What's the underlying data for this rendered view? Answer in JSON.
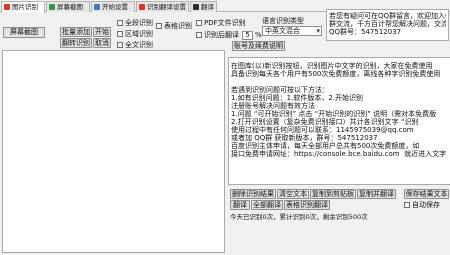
{
  "tabs": [
    {
      "label": "图片识别",
      "icon": "image-icon",
      "icon_color": "#d8382c",
      "active": true
    },
    {
      "label": "屏幕截图",
      "icon": "screenshot-icon",
      "icon_color": "#2f9a45",
      "active": false
    },
    {
      "label": "开始设置",
      "icon": "settings-icon",
      "icon_color": "#4a78b8",
      "active": false
    },
    {
      "label": "识别翻译设置",
      "icon": "translate-icon",
      "icon_color": "#d8382c",
      "active": false
    },
    {
      "label": "翻译",
      "icon": "globe-icon",
      "icon_color": "#2b2b2b",
      "active": false
    }
  ],
  "toolbar": {
    "screenshot_button": "屏幕截图",
    "batch_add_button": "批量添加",
    "start_button": "开始",
    "rotate_button": "翻转识别",
    "cancel_button": "取消",
    "options": [
      {
        "label": "全段识别",
        "checked": false
      },
      {
        "label": "区域识别",
        "checked": false
      },
      {
        "label": "全文识别",
        "checked": false
      },
      {
        "label": "表格识别",
        "checked": false
      },
      {
        "label": "PDF文件识别",
        "checked": false
      },
      {
        "label": "识别后翻译",
        "checked": false
      }
    ],
    "translate_value": "5",
    "translate_unit": "%",
    "language_label": "语言识别类型",
    "language_value": "中英文混合",
    "account_button": "账号及续费说明"
  },
  "notice": {
    "lines": [
      "若您有疑问可在QQ群留言，欢迎加入QQ",
      "群交流，千方百计帮您解决问题，交流",
      "QQ群号：547512037"
    ]
  },
  "result": {
    "lines": [
      "在图库(以)新识别按钮，识别图片中文字的识别，大家在免费使用",
      "具备识别每天各个用户有500次免费额度，离线各种字识别免费使用",
      "",
      "若遇到识别问题可按以下方法：",
      "1.如有识别问题：1.软件版本，2.开始识别",
      "注册账号解决问题有效方法",
      "1.问题 “可开始识别” 点击 “开始识别的识别” 说明（需对本免费版",
      "2.打开识别设置（复杂免费识别接口）共计各识别文字 “识别",
      "使用过程中有任何问题可以联系：1145975039@qq.com",
      "或者加 QQ群 获取新版本，群号：547512037",
      "百度识别主体申请，每天全部用户总共有500次免费额度，如",
      "接口免费申请网址：https://console.bce.baidu.com  就近进入文字"
    ]
  },
  "actions": {
    "delete_results": "删除识别结果",
    "clear_text": "清空文本",
    "copy_clipboard": "复制到剪贴板",
    "copy_translate": "复制并翻译",
    "translate": "翻译",
    "translate_all": "全部翻译",
    "table_translate": "表格识别翻译",
    "save_text": "保存结果文本",
    "auto_save": {
      "label": "自动保存",
      "checked": false
    }
  },
  "status": "今天已识别0次，累计识别0次，剩余识别500次"
}
